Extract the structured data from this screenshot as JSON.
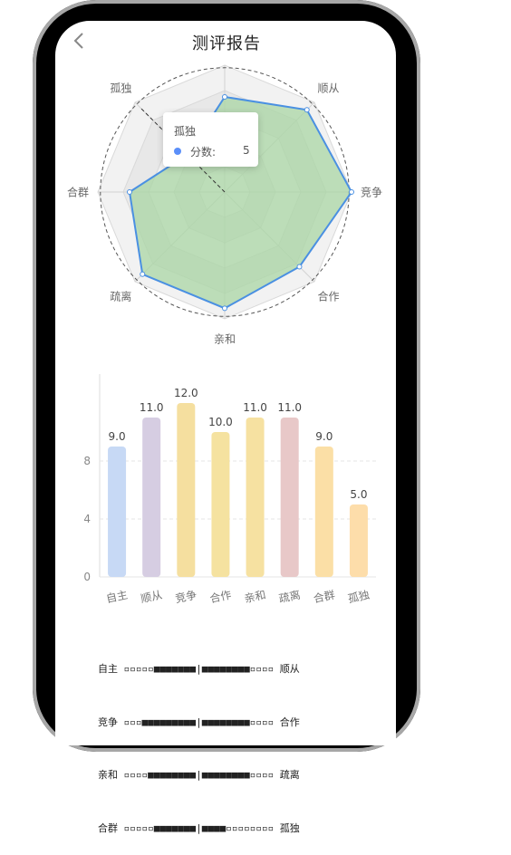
{
  "nav": {
    "title": "测评报告",
    "back_icon": "chevron-left-icon"
  },
  "colors": {
    "radar_stroke": "#4a90e2",
    "radar_fill": "#a9d6a4",
    "tooltip_dot": "#5b8ff9",
    "bars": [
      "#c7d9f5",
      "#d6cde2",
      "#f5df9f",
      "#f5e2a0",
      "#f6e1a1",
      "#e8c8c8",
      "#fbdfa6",
      "#fdddaa"
    ]
  },
  "tooltip": {
    "title": "孤独",
    "key": "分数:",
    "value": "5"
  },
  "chart_data": [
    {
      "type": "radar",
      "categories": [
        "自主",
        "顺从",
        "竞争",
        "合作",
        "亲和",
        "疏离",
        "合群",
        "孤独"
      ],
      "values": [
        9,
        11,
        12,
        10,
        11,
        11,
        9,
        5
      ],
      "max": 12,
      "visible_labels": [
        "顺从",
        "竞争",
        "合作",
        "亲和",
        "疏离",
        "合群",
        "孤独"
      ]
    },
    {
      "type": "bar",
      "categories": [
        "自主",
        "顺从",
        "竞争",
        "合作",
        "亲和",
        "疏离",
        "合群",
        "孤独"
      ],
      "values": [
        9.0,
        11.0,
        12.0,
        10.0,
        11.0,
        11.0,
        9.0,
        5.0
      ],
      "value_labels": [
        "9.0",
        "11.0",
        "12.0",
        "10.0",
        "11.0",
        "11.0",
        "9.0",
        "5.0"
      ],
      "ylim": [
        0,
        14
      ],
      "yticks": [
        0,
        4,
        8
      ],
      "grid": true
    }
  ],
  "legend_lines": [
    "自主 ▫▫▫▫▫■■■■■■■|■■■■■■■■▫▫▫▫ 顺从",
    "竞争 ▫▫▫■■■■■■■■■|■■■■■■■■▫▫▫▫ 合作",
    "亲和 ▫▫▫▫■■■■■■■■|■■■■■■■■▫▫▫▫ 疏离",
    "合群 ▫▫▫▫▫■■■■■■■|■■■■▫▫▫▫▫▫▫▫ 孤独"
  ]
}
